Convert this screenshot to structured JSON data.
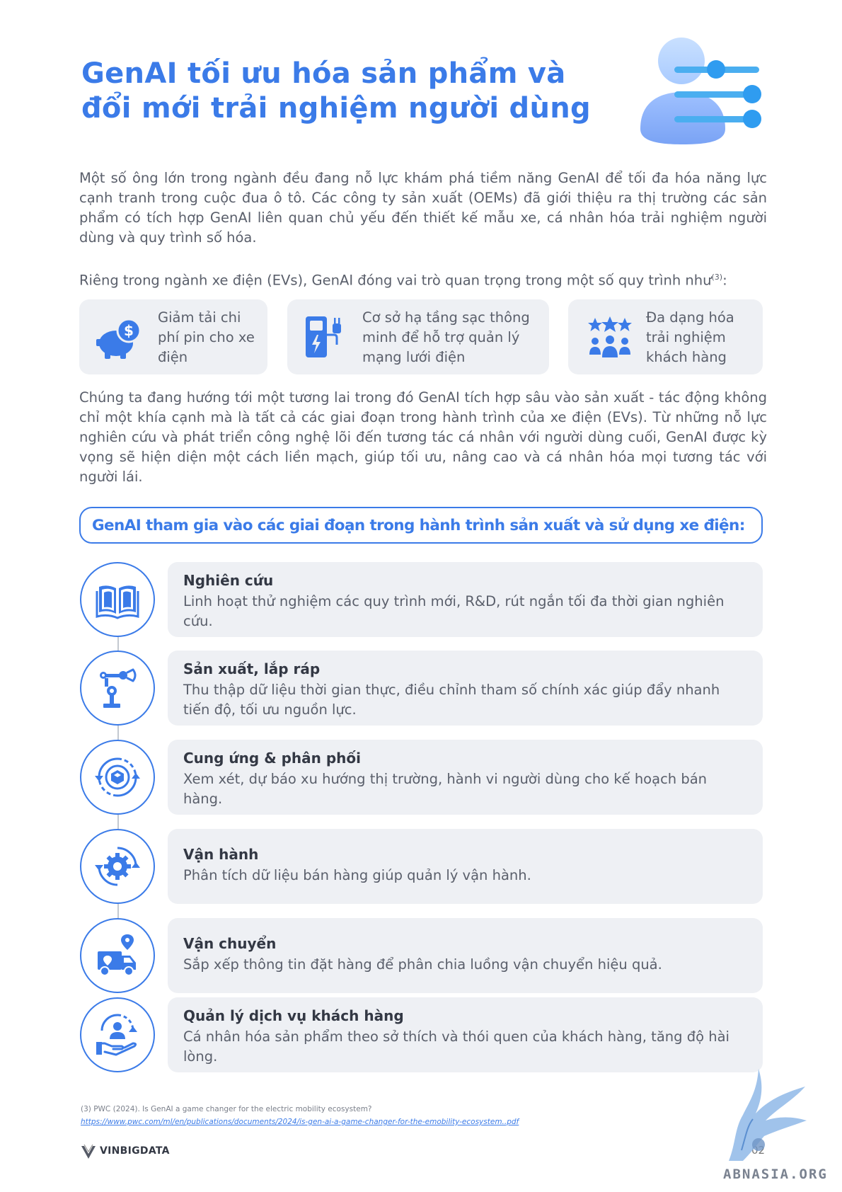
{
  "title": {
    "line1": "GenAI tối ưu hóa sản phẩm và",
    "line2": "đổi mới trải nghiệm người dùng"
  },
  "intro": {
    "paragraph1": "Một số ông lớn trong ngành đều đang nỗ lực khám phá tiềm năng GenAI để tối đa hóa năng lực cạnh tranh trong cuộc đua ô tô. Các công ty sản xuất (OEMs) đã giới thiệu ra thị trường các sản phẩm có tích hợp GenAI liên quan chủ yếu đến thiết kế mẫu xe, cá nhân hóa trải nghiệm người dùng và quy trình số hóa.",
    "paragraph2": "Riêng trong ngành xe điện (EVs), GenAI đóng vai trò quan trọng trong một số quy trình như",
    "paragraph2_ref": "(3)",
    "paragraph2_end": ":"
  },
  "cards": [
    {
      "label": "Giảm tải chi phí pin cho xe điện",
      "icon": "piggy-bank-dollar-icon"
    },
    {
      "label": "Cơ sở hạ tầng sạc thông minh để hỗ trợ quản lý mạng lưới điện",
      "icon": "charging-station-icon"
    },
    {
      "label": "Đa dạng hóa trải nghiệm khách hàng",
      "icon": "rating-stars-people-icon"
    }
  ],
  "paragraph3": "Chúng ta đang hướng tới một tương lai trong đó GenAI tích hợp sâu vào sản xuất - tác động không chỉ một khía cạnh mà là tất cả các giai đoạn trong hành trình của xe điện (EVs). Từ những nỗ lực nghiên cứu và phát triển công nghệ lõi đến tương tác cá nhân với người dùng cuối, GenAI được kỳ vọng sẽ hiện diện một cách liền mạch, giúp tối ưu, nâng cao và cá nhân hóa mọi tương tác với người lái.",
  "section_heading": "GenAI tham gia vào các giai đoạn trong hành trình sản xuất và sử dụng xe điện:",
  "steps": [
    {
      "title": "Nghiên cứu",
      "desc": "Linh hoạt thử nghiệm các quy trình mới, R&D, rút ngắn tối đa thời gian nghiên cứu.",
      "icon": "open-book-icon"
    },
    {
      "title": "Sản xuất, lắp ráp",
      "desc": "Thu thập dữ liệu thời gian thực, điều chỉnh tham số chính xác giúp đẩy nhanh tiến độ, tối ưu nguồn lực.",
      "icon": "robot-arm-icon"
    },
    {
      "title": "Cung ứng & phân phối",
      "desc": "Xem xét, dự báo xu hướng thị trường, hành vi người dùng cho kế hoạch bán hàng.",
      "icon": "supply-cycle-icon"
    },
    {
      "title": "Vận hành",
      "desc": "Phân tích dữ liệu bán hàng giúp quản lý vận hành.",
      "icon": "gear-cycle-icon"
    },
    {
      "title": "Vận chuyển",
      "desc": "Sắp xếp thông tin đặt hàng để phân chia luồng vận chuyển hiệu quả.",
      "icon": "delivery-truck-icon"
    },
    {
      "title": "Quản lý dịch vụ khách hàng",
      "desc": "Cá nhân hóa sản phẩm theo sở thích và thói quen của khách hàng, tăng độ hài lòng.",
      "icon": "customer-care-icon"
    }
  ],
  "footnote": {
    "citation": "(3) PWC (2024). Is GenAI a game changer for the electric mobility ecosystem?",
    "link": "https://www.pwc.com/ml/en/publications/documents/2024/is-gen-ai-a-game-changer-for-the-emobility-ecosystem..pdf"
  },
  "logo_text": "VINBIGDATA",
  "page_number": "02",
  "watermark": "ABNASIA.ORG",
  "colors": {
    "accent": "#3b7be8",
    "card_bg": "#eef0f4",
    "text": "#5a5f6b"
  }
}
